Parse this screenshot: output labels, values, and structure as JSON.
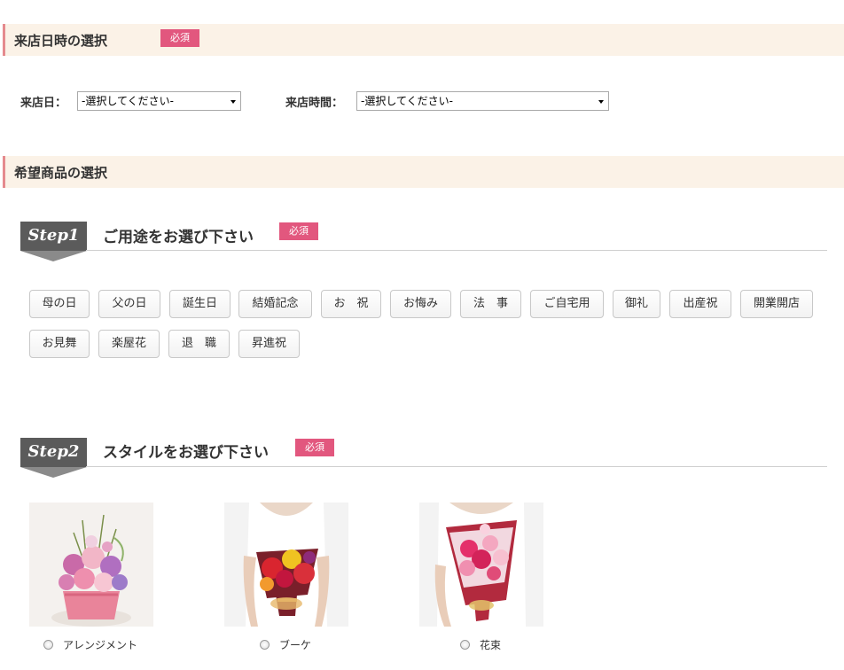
{
  "visit_section": {
    "title": "来店日時の選択",
    "required": "必須",
    "date_label": "来店日：",
    "date_value": "-選択してください-",
    "time_label": "来店時間：",
    "time_value": "-選択してください-"
  },
  "product_section": {
    "title": "希望商品の選択"
  },
  "step1": {
    "badge": "Step1",
    "title": "ご用途をお選び下さい",
    "required": "必須",
    "purposes": [
      "母の日",
      "父の日",
      "誕生日",
      "結婚記念",
      "お　祝",
      "お悔み",
      "法　事",
      "ご自宅用",
      "御礼",
      "出産祝",
      "開業開店",
      "お見舞",
      "楽屋花",
      "退　職",
      "昇進祝"
    ]
  },
  "step2": {
    "badge": "Step2",
    "title": "スタイルをお選び下さい",
    "required": "必須",
    "styles": [
      {
        "label": "アレンジメント",
        "image": "arrangement"
      },
      {
        "label": "ブーケ",
        "image": "bouquet"
      },
      {
        "label": "花束",
        "image": "bunch"
      }
    ]
  }
}
